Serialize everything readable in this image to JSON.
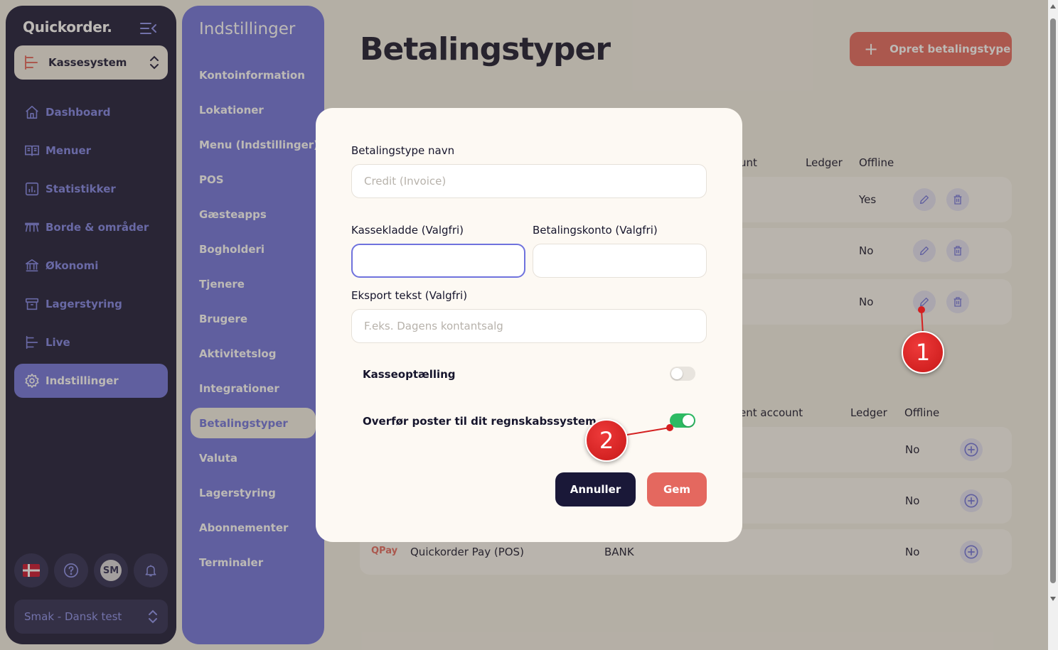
{
  "app": {
    "brand": "Quickorder.",
    "system_selector": "Kassesystem",
    "venue_selector": "Smak - Dansk test",
    "avatar_initials": "SM"
  },
  "nav": {
    "items": [
      {
        "label": "Dashboard",
        "icon": "home-icon"
      },
      {
        "label": "Menuer",
        "icon": "book-icon"
      },
      {
        "label": "Statistikker",
        "icon": "chart-icon"
      },
      {
        "label": "Borde & områder",
        "icon": "table-icon"
      },
      {
        "label": "Økonomi",
        "icon": "bank-icon"
      },
      {
        "label": "Lagerstyring",
        "icon": "archive-icon"
      },
      {
        "label": "Live",
        "icon": "live-icon"
      },
      {
        "label": "Indstillinger",
        "icon": "gear-icon",
        "active": true
      }
    ]
  },
  "settings_nav": {
    "title": "Indstillinger",
    "items": [
      "Kontoinformation",
      "Lokationer",
      "Menu (Indstillinger)",
      "POS",
      "Gæsteapps",
      "Bogholderi",
      "Tjenere",
      "Brugere",
      "Aktivitetslog",
      "Integrationer",
      "Betalingstyper",
      "Valuta",
      "Lagerstyring",
      "Abonnementer",
      "Terminaler"
    ],
    "active": "Betalingstyper"
  },
  "main": {
    "title": "Betalingstyper",
    "create_button": "Opret betalingstype",
    "table1": {
      "headers": {
        "account": "unt",
        "ledger": "Ledger",
        "offline": "Offline"
      },
      "rows": [
        {
          "offline": "Yes"
        },
        {
          "offline": "No"
        },
        {
          "offline": "No"
        }
      ]
    },
    "table2": {
      "headers": {
        "account": "ent account",
        "ledger": "Ledger",
        "offline": "Offline"
      },
      "rows": [
        {
          "offline": "No"
        },
        {
          "offline": "No"
        },
        {
          "logo": "QPay",
          "name": "Quickorder Pay (POS)",
          "account": "BANK",
          "offline": "No"
        }
      ]
    }
  },
  "modal": {
    "name_label": "Betalingstype navn",
    "name_placeholder": "Credit (Invoice)",
    "cashbook_label": "Kassekladde (Valgfri)",
    "cashbook_value": "",
    "account_label": "Betalingskonto (Valgfri)",
    "account_value": "",
    "export_label": "Eksport tekst (Valgfri)",
    "export_placeholder": "F.eks. Dagens kontantsalg",
    "toggle_cashcount": {
      "label": "Kasseoptælling",
      "on": false
    },
    "toggle_transfer": {
      "label": "Overfør poster til dit regnskabssystem",
      "on": true
    },
    "cancel": "Annuller",
    "save": "Gem"
  },
  "annotations": {
    "marker1": "1",
    "marker2": "2"
  },
  "colors": {
    "navy": "#1a1838",
    "accent": "#6f72dd",
    "brand_red": "#e4685f",
    "toggle_on": "#2dbb63",
    "marker_red": "#d42020"
  }
}
